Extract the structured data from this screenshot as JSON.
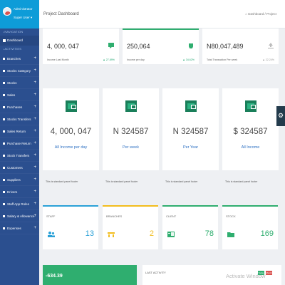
{
  "user": {
    "name": "Administrator",
    "role": "Super User ▾"
  },
  "sidebar": {
    "nav_section": "NAVIGATION",
    "dashboard": "Dashboard",
    "act_section": "ACTIVITIES",
    "items": [
      {
        "label": "Branches"
      },
      {
        "label": "Stocks Category"
      },
      {
        "label": "Stocks"
      },
      {
        "label": "Sales"
      },
      {
        "label": "Purchases"
      },
      {
        "label": "Stocks Transfers"
      },
      {
        "label": "Sales Return"
      },
      {
        "label": "Purchase Return"
      },
      {
        "label": "Stock Transfers"
      },
      {
        "label": "Customers"
      },
      {
        "label": "Suppliers"
      },
      {
        "label": "Drivers"
      },
      {
        "label": "Staff App Roles"
      },
      {
        "label": "Salary & Allowance"
      },
      {
        "label": "Expenses"
      }
    ]
  },
  "header": {
    "title": "Project Dashboard",
    "breadcrumb": "Dashboard / Project",
    "home_icon": "home-icon"
  },
  "stats": [
    {
      "value": "4, 000, 047",
      "label": "Income Last Month",
      "change": "▲ 27.89%",
      "icon": "chat-icon",
      "accent": ""
    },
    {
      "value": "250,064",
      "label": "Income per day",
      "change": "▲ 34.62%",
      "icon": "cup-icon",
      "accent": "#2fae6f"
    },
    {
      "value": "N80,047,489",
      "label": "Total Transaction Per week",
      "change": "▲ 22.24%",
      "icon": "upload-icon",
      "accent": ""
    }
  ],
  "income_cards": [
    {
      "value": "4, 000, 047",
      "label": "All Income per day",
      "footer": "This is standard panel footer"
    },
    {
      "value": "N 324587",
      "label": "Per week",
      "footer": "This is standard panel footer"
    },
    {
      "value": "N 324587",
      "label": "Per Year",
      "footer": "This is standard panel footer"
    },
    {
      "value": "$ 324587",
      "label": "All Income",
      "footer": "This is standard panel footer"
    }
  ],
  "counters": [
    {
      "label": "STAFF",
      "value": "13",
      "color": "#2ba1d7",
      "icon": "users-icon"
    },
    {
      "label": "BRANCHES",
      "value": "2",
      "color": "#f2bd1d",
      "icon": "branches-icon"
    },
    {
      "label": "CLIENT",
      "value": "78",
      "color": "#2fae6f",
      "icon": "client-icon"
    },
    {
      "label": "STOCK",
      "value": "169",
      "color": "#2fae6f",
      "icon": "folder-icon"
    }
  ],
  "green_panel": {
    "value": "-634.39"
  },
  "activity": {
    "title": "LAST ACTIVITY",
    "watermark": "Activate Window",
    "btn1": "Today",
    "btn2": "Month"
  },
  "colors": {
    "sidebar": "#2b4f8f",
    "topbar": "#0e9cd8",
    "green": "#2fae6f",
    "icon_green": "#1a7f5a"
  }
}
